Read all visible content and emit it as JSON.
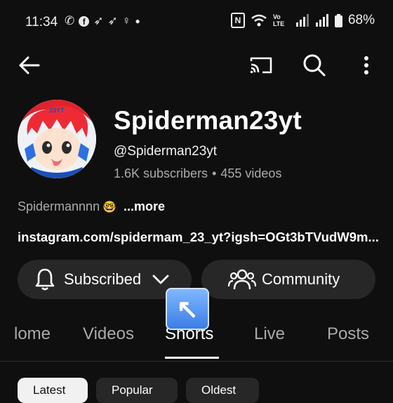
{
  "status_bar": {
    "time": "11:34",
    "left_icons": [
      "whatsapp-icon",
      "facebook-icon",
      "feather-icon",
      "feather-icon",
      "walk-icon",
      "dot-icon"
    ],
    "battery": "68%",
    "network": "Vo LTE"
  },
  "app_bar": {
    "icons": [
      "back-arrow-icon",
      "cast-icon",
      "search-icon",
      "more-vert-icon"
    ]
  },
  "channel": {
    "name": "Spiderman23yt",
    "handle": "@Spiderman23yt",
    "subscribers": "1.6K subscribers",
    "separator": "•",
    "videos": "455 videos",
    "description": "Spidermannnn",
    "description_emoji": "🤓",
    "more_label": "...more",
    "link": "instagram.com/spidermam_23_yt?igsh=OGt3bTVudW9m...",
    "avatar_text": "23YT"
  },
  "actions": {
    "subscribed_label": "Subscribed",
    "community_label": "Community"
  },
  "tabs": [
    {
      "label": "lome"
    },
    {
      "label": "Videos"
    },
    {
      "label": "Shorts"
    },
    {
      "label": "Live"
    },
    {
      "label": "Posts"
    }
  ],
  "active_tab": "Shorts",
  "chips": [
    "Latest",
    "Popular",
    "Oldest"
  ],
  "overlay_icon": "up-left-arrow-icon",
  "colors": {
    "background": "#0f0f0f",
    "button_bg": "#272727",
    "secondary_text": "#aaaaaa",
    "chip_active_bg": "#f1f1f1"
  }
}
